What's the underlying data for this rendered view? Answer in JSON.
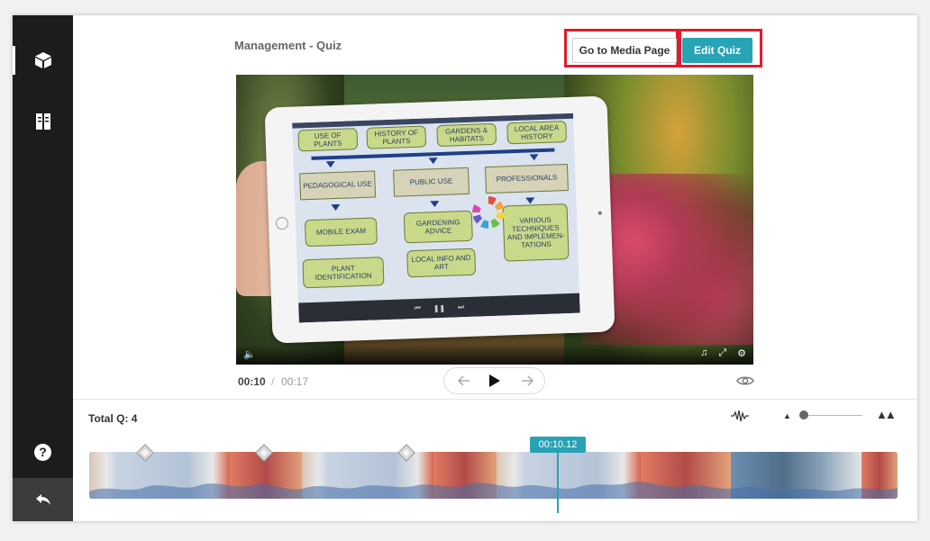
{
  "header": {
    "media_title": "Management - Quiz",
    "go_to_media_label": "Go to Media Page",
    "edit_quiz_label": "Edit Quiz"
  },
  "sidebar": {
    "items": [
      {
        "icon": "cube-icon"
      },
      {
        "icon": "book-icon"
      }
    ],
    "help_label": "?",
    "back_icon": "back-arrow-icon"
  },
  "video": {
    "slide": {
      "top_boxes": [
        "USE OF PLANTS",
        "HISTORY OF PLANTS",
        "GARDENS & HABITATS",
        "LOCAL AREA HISTORY"
      ],
      "mid_boxes": [
        "PEDAGOGICAL USE",
        "PUBLIC USE",
        "PROFESSIONALS"
      ],
      "bottom_boxes": [
        "MOBILE EXAM",
        "GARDENING ADVICE",
        "VARIOUS TECHNIQUES AND IMPLEMEN-TATIONS",
        "PLANT IDENTIFICATION",
        "LOCAL INFO AND ART"
      ]
    }
  },
  "player": {
    "current_time": "00:10",
    "separator": "/",
    "total_time": "00:17"
  },
  "timeline": {
    "total_questions_label": "Total Q: 4",
    "playhead_time": "00:10.12"
  },
  "colors": {
    "accent": "#27a3b5",
    "highlight": "#e31a2c",
    "sidebar": "#1c1c1c"
  }
}
